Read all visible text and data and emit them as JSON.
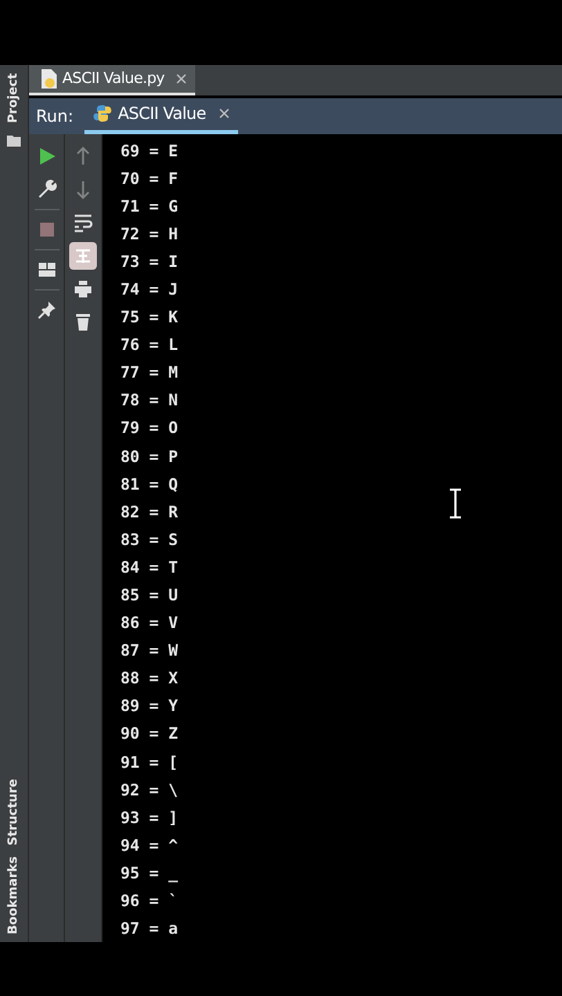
{
  "side_strip": {
    "top_label": "Project",
    "bottom_labels": [
      "Structure",
      "Bookmarks"
    ]
  },
  "editor_tabs": [
    {
      "title": "ASCII Value.py",
      "selected": true
    }
  ],
  "run_panel": {
    "label": "Run:",
    "tabs": [
      {
        "title": "ASCII Value",
        "selected": true
      }
    ]
  },
  "left_tools": [
    {
      "kind": "run",
      "disabled": false
    },
    {
      "kind": "wrench",
      "disabled": false
    },
    {
      "kind": "stop",
      "disabled": true
    },
    {
      "kind": "layout",
      "disabled": false
    },
    {
      "kind": "pin",
      "disabled": false
    }
  ],
  "right_tools": [
    {
      "kind": "up",
      "disabled": true,
      "selected": false
    },
    {
      "kind": "down",
      "disabled": true,
      "selected": false
    },
    {
      "kind": "wrap",
      "disabled": false,
      "selected": false
    },
    {
      "kind": "scroll",
      "disabled": false,
      "selected": true
    },
    {
      "kind": "print",
      "disabled": false,
      "selected": false
    },
    {
      "kind": "trash",
      "disabled": false,
      "selected": false
    }
  ],
  "output_lines": [
    "69 = E",
    "70 = F",
    "71 = G",
    "72 = H",
    "73 = I",
    "74 = J",
    "75 = K",
    "76 = L",
    "77 = M",
    "78 = N",
    "79 = O",
    "80 = P",
    "81 = Q",
    "82 = R",
    "83 = S",
    "84 = T",
    "85 = U",
    "86 = V",
    "87 = W",
    "88 = X",
    "89 = Y",
    "90 = Z",
    "91 = [",
    "92 = \\",
    "93 = ]",
    "94 = ^",
    "95 = _",
    "96 = `",
    "97 = a"
  ]
}
